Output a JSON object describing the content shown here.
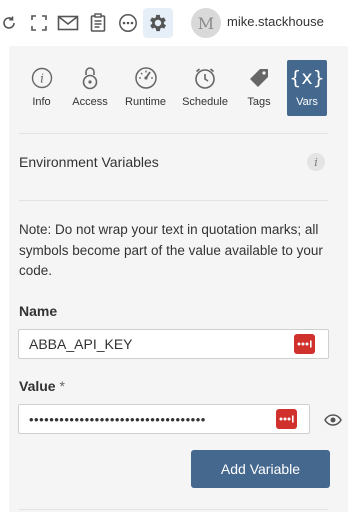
{
  "user": {
    "name": "mike.stackhouse",
    "avatar_letter": "M"
  },
  "toolbar": {
    "icons": [
      "refresh-icon",
      "fullscreen-icon",
      "mail-icon",
      "clipboard-icon",
      "more-icon",
      "gear-icon"
    ]
  },
  "tabs": [
    {
      "label": "Info",
      "icon": "info-icon"
    },
    {
      "label": "Access",
      "icon": "lock-icon"
    },
    {
      "label": "Runtime",
      "icon": "gauge-icon"
    },
    {
      "label": "Schedule",
      "icon": "clock-icon"
    },
    {
      "label": "Tags",
      "icon": "tag-icon"
    },
    {
      "label": "Vars",
      "icon": "braces-x-icon",
      "glyph": "{x}",
      "active": true
    }
  ],
  "section": {
    "title": "Environment Variables",
    "info": "i"
  },
  "note": "Note: Do not wrap your text in quotation marks; all symbols become part of the value available to your code.",
  "name_field": {
    "label": "Name",
    "value": "ABBA_API_KEY"
  },
  "value_field": {
    "label": "Value",
    "required_mark": "*",
    "value": "•••••••••••••••••••••••••••••••••••"
  },
  "add_button": {
    "label": "Add Variable"
  },
  "colors": {
    "accent": "#45688e",
    "panel": "#f5f5f5",
    "password_manager": "#d0312d"
  }
}
